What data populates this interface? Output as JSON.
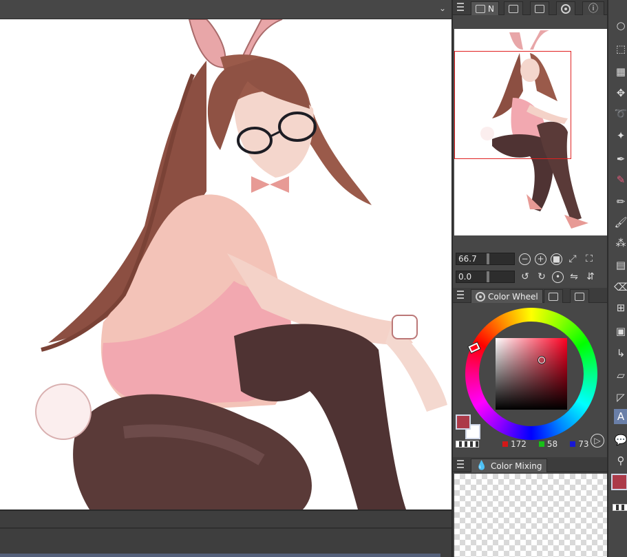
{
  "app": {
    "accent": "#ac3a49"
  },
  "canvas": {
    "chevron_icon": "chevron-down-icon",
    "background": "#ffffff"
  },
  "panel": {
    "top_tabs": [
      {
        "label": "N",
        "icon": "layers-icon"
      },
      {
        "label": "",
        "icon": "animation-icon"
      },
      {
        "label": "",
        "icon": "pages-icon"
      },
      {
        "label": "",
        "icon": "sub-view-icon"
      },
      {
        "label": "",
        "icon": "info-icon"
      }
    ],
    "navigator": {
      "zoom_value": "66.7",
      "rotation_value": "0.0"
    },
    "color_wheel_tab": {
      "label": "Color Wheel"
    },
    "color": {
      "r": "172",
      "g": "58",
      "b": "73",
      "main_color": "#ac3a49",
      "sub_color": "#ffffff"
    },
    "color_mixing_tab": {
      "label": "Color Mixing"
    }
  },
  "toolbar": {
    "tools": [
      "zoom-tool-icon",
      "selection-marquee-icon",
      "auto-select-icon",
      "move-icon",
      "lasso-icon",
      "wand-icon",
      "pen-icon",
      "eraser-brush-icon",
      "pencil-icon",
      "brush-icon",
      "airbrush-icon",
      "gradient-icon",
      "eraser-icon",
      "grid-icon",
      "fill-icon",
      "curve-icon",
      "ruler-icon",
      "figure-icon",
      "text-icon",
      "balloon-icon",
      "eyedropper-icon"
    ],
    "selected_tool": "text-icon"
  }
}
